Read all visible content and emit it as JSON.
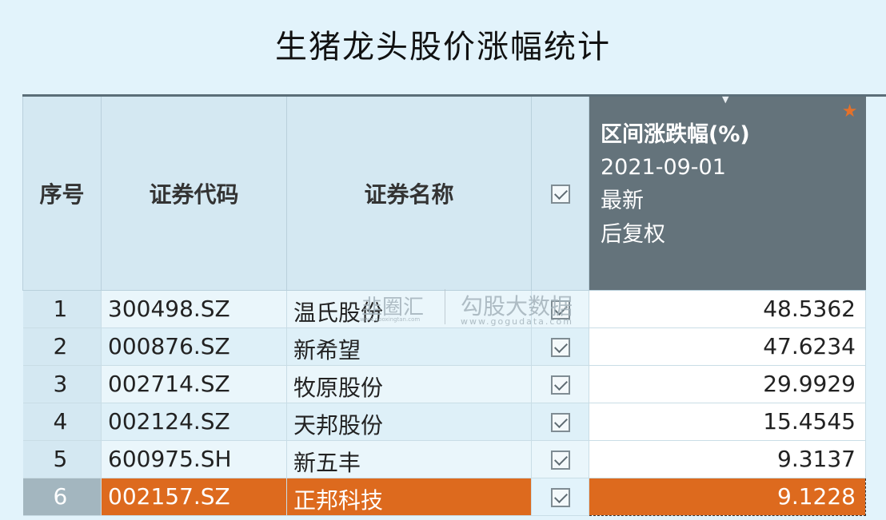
{
  "title": "生猪龙头股价涨幅统计",
  "table": {
    "columns": {
      "seq": "序号",
      "code": "证券代码",
      "name": "证券名称",
      "change": {
        "label": "区间涨跌幅(%)",
        "date": "2021-09-01",
        "line3": "最新",
        "line4": "后复权"
      }
    },
    "rows": [
      {
        "seq": "1",
        "code": "300498.SZ",
        "name": "温氏股份",
        "checked": true,
        "change": "48.5362"
      },
      {
        "seq": "2",
        "code": "000876.SZ",
        "name": "新希望",
        "checked": true,
        "change": "47.6234"
      },
      {
        "seq": "3",
        "code": "002714.SZ",
        "name": "牧原股份",
        "checked": true,
        "change": "29.9929"
      },
      {
        "seq": "4",
        "code": "002124.SZ",
        "name": "天邦股份",
        "checked": true,
        "change": "15.4545"
      },
      {
        "seq": "5",
        "code": "600975.SH",
        "name": "新五丰",
        "checked": true,
        "change": "9.3137"
      },
      {
        "seq": "6",
        "code": "002157.SZ",
        "name": "正邦科技",
        "checked": true,
        "change": "9.1228",
        "selected": true
      }
    ]
  },
  "watermark": {
    "brand1": "韭圈汇",
    "brand1_url": "www.gooxingtan.com",
    "brand2": "勾股大数据",
    "brand2_url": "www.gogudata.com"
  },
  "icons": {
    "star": "star-icon",
    "checkbox": "checkbox-checked-icon",
    "sort": "sort-indicator-icon"
  },
  "colors": {
    "background": "#e2f3fb",
    "header_bg": "#d4e8f2",
    "active_column": "#64737b",
    "selection": "#dd6a1e",
    "star": "#e4712a"
  }
}
